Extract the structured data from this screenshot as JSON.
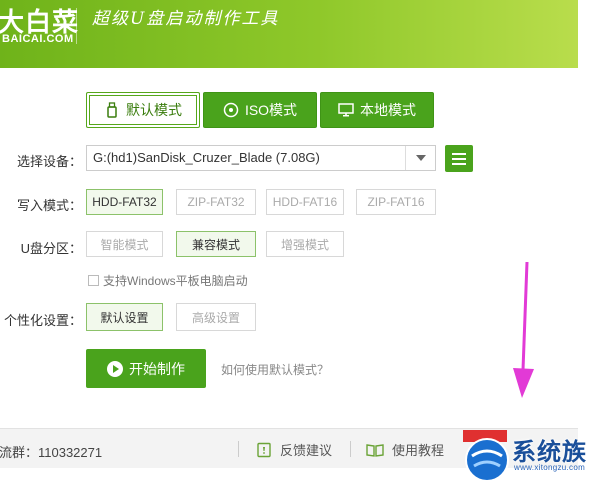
{
  "header": {
    "logo_text": "大白菜",
    "logo_sub": "BAICAI.COM",
    "slogan": "超级U盘启动制作工具"
  },
  "tabs": [
    {
      "label": "默认模式",
      "icon": "usb-icon",
      "active": true
    },
    {
      "label": "ISO模式",
      "icon": "disc-icon",
      "active": false
    },
    {
      "label": "本地模式",
      "icon": "monitor-icon",
      "active": false
    }
  ],
  "device": {
    "label": "选择设备：",
    "value": "G:(hd1)SanDisk_Cruzer_Blade (7.08G)"
  },
  "write_mode": {
    "label": "写入模式：",
    "options": [
      "HDD-FAT32",
      "ZIP-FAT32",
      "HDD-FAT16",
      "ZIP-FAT16"
    ],
    "selected": "HDD-FAT32"
  },
  "partition": {
    "label": "U盘分区：",
    "options": [
      "智能模式",
      "兼容模式",
      "增强模式"
    ],
    "selected": "兼容模式"
  },
  "windows_tablet": {
    "label": "支持Windows平板电脑启动",
    "checked": false
  },
  "personalize": {
    "label": "个性化设置：",
    "options": [
      "默认设置",
      "高级设置"
    ],
    "selected": "默认设置"
  },
  "start_button": "开始制作",
  "help_link": "如何使用默认模式？",
  "footer": {
    "qq_group": "流群：110332271",
    "feedback": "反馈建议",
    "tutorial": "使用教程"
  },
  "watermark": {
    "text": "系统族",
    "sub": "www.xitongzu.com"
  },
  "colors": {
    "brand_green": "#4aa31c",
    "arrow": "#e23ad6"
  }
}
